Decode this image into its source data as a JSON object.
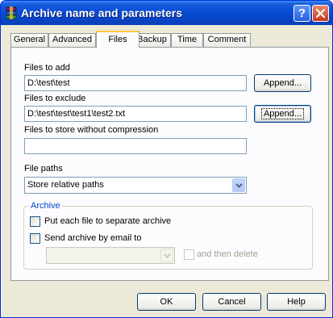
{
  "window": {
    "title": "Archive name and parameters"
  },
  "tabs": [
    {
      "label": "General"
    },
    {
      "label": "Advanced"
    },
    {
      "label": "Files"
    },
    {
      "label": "Backup"
    },
    {
      "label": "Time"
    },
    {
      "label": "Comment"
    }
  ],
  "files_to_add": {
    "label": "Files to add",
    "value": "D:\\test\\test",
    "button": "Append..."
  },
  "files_to_exclude": {
    "label": "Files to exclude",
    "value": "D:\\test\\test\\test1\\test2.txt",
    "button": "Append..."
  },
  "files_no_compress": {
    "label": "Files to store without compression",
    "value": ""
  },
  "file_paths": {
    "label": "File paths",
    "selected": "Store relative paths"
  },
  "archive_group": {
    "title": "Archive",
    "separate_label": "Put each file to separate archive",
    "email_label": "Send archive by email to",
    "email_value": "",
    "then_delete_label": "and then delete"
  },
  "footer": {
    "ok": "OK",
    "cancel": "Cancel",
    "help": "Help"
  },
  "icons": {
    "help": "question-mark-icon",
    "close": "close-icon",
    "app": "winrar-books-icon",
    "dropdown": "chevron-down-icon"
  }
}
